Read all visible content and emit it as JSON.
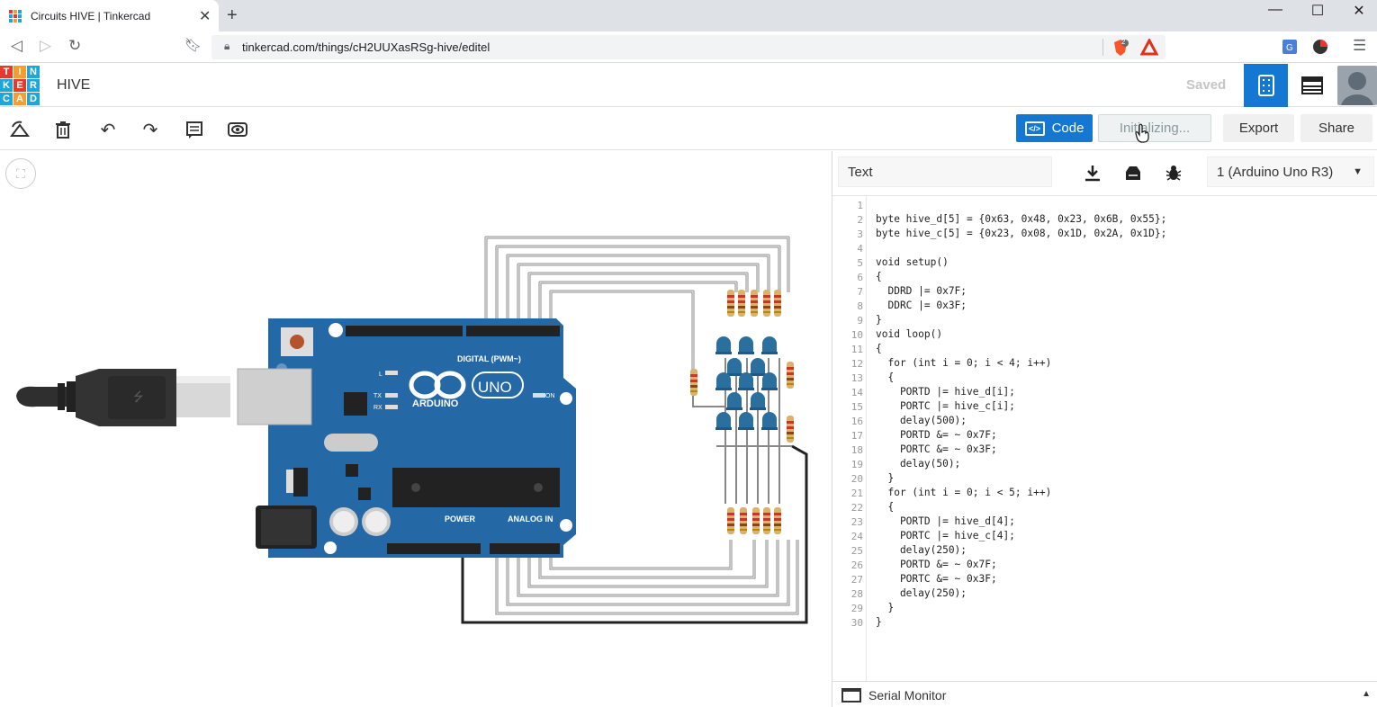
{
  "browser": {
    "tab_title": "Circuits HIVE | Tinkercad",
    "tab_close": "✕",
    "new_tab": "+",
    "url": "tinkercad.com/things/cH2UUXasRSg-hive/editel",
    "brave_badge": "2",
    "window_controls": {
      "minimize": "—",
      "maximize": "☐",
      "close": "✕"
    }
  },
  "header": {
    "logo_letters": [
      "T",
      "I",
      "N",
      "K",
      "E",
      "R",
      "C",
      "A",
      "D"
    ],
    "logo_colors": [
      "#e6392e",
      "#f79c2d",
      "#1fa6d8",
      "#1fa6d8",
      "#e6392e",
      "#1fa6d8",
      "#1fa6d8",
      "#f79c2d",
      "#1fa6d8"
    ],
    "design_title": "HIVE",
    "save_status": "Saved"
  },
  "toolbar": {
    "code_label": "Code",
    "code_icon_text": "</>",
    "initializing_label": "Initializing...",
    "export_label": "Export",
    "share_label": "Share"
  },
  "board": {
    "brand": "ARDUINO",
    "model": "UNO",
    "digital_label": "DIGITAL (PWM~)",
    "power_label": "POWER",
    "analog_label": "ANALOG IN",
    "on_label": "ON",
    "tx_label": "TX",
    "rx_label": "RX",
    "l_label": "L"
  },
  "code_panel": {
    "mode": "Text",
    "device": "1 (Arduino Uno R3)",
    "serial_monitor": "Serial Monitor",
    "lines": [
      "",
      "byte hive_d[5] = {0x63, 0x48, 0x23, 0x6B, 0x55};",
      "byte hive_c[5] = {0x23, 0x08, 0x1D, 0x2A, 0x1D};",
      "",
      "void setup()",
      "{",
      "  DDRD |= 0x7F;",
      "  DDRC |= 0x3F;",
      "}",
      "void loop()",
      "{",
      "  for (int i = 0; i < 4; i++)",
      "  {",
      "    PORTD |= hive_d[i];",
      "    PORTC |= hive_c[i];",
      "    delay(500);",
      "    PORTD &= ~ 0x7F;",
      "    PORTC &= ~ 0x3F;",
      "    delay(50);",
      "  }",
      "  for (int i = 0; i < 5; i++)",
      "  {",
      "    PORTD |= hive_d[4];",
      "    PORTC |= hive_c[4];",
      "    delay(250);",
      "    PORTD &= ~ 0x7F;",
      "    PORTC &= ~ 0x3F;",
      "    delay(250);",
      "  }",
      "}"
    ]
  }
}
